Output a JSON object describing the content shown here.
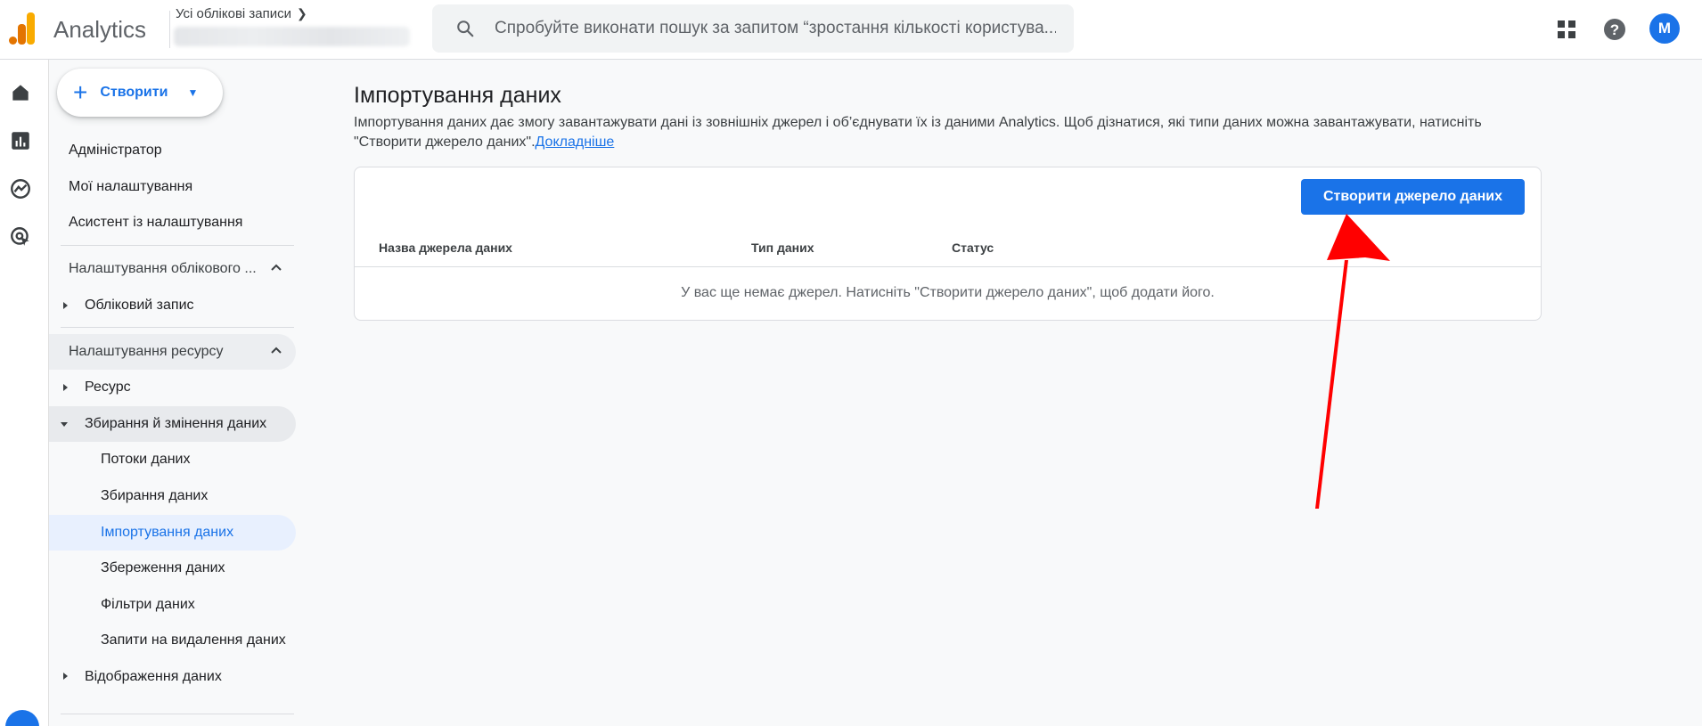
{
  "header": {
    "app_name": "Analytics",
    "breadcrumb": "Усі облікові записи",
    "search_placeholder": "Спробуйте виконати пошук за запитом “зростання кількості користува...",
    "avatar_letter": "M"
  },
  "colors": {
    "brand_orange": "#f9ab00",
    "brand_dark_orange": "#e37400",
    "accent_blue": "#1a73e8",
    "annotation_red": "#ff0000"
  },
  "icons": [
    "analytics-logo-icon",
    "search-icon",
    "apps-grid-icon",
    "help-icon",
    "home-icon",
    "reports-icon",
    "explore-icon",
    "advertising-icon",
    "admin-gear-icon"
  ],
  "sidebar": {
    "create_label": "Створити",
    "admin": "Адміністратор",
    "my_settings": "Мої налаштування",
    "setup_assistant": "Асистент із налаштування",
    "account_settings": "Налаштування облікового ...",
    "account": "Обліковий запис",
    "property_settings": "Налаштування ресурсу",
    "property": "Ресурс",
    "data_collection": "Збирання й змінення даних",
    "data_streams": "Потоки даних",
    "data_collection_sub": "Збирання даних",
    "data_import": "Імпортування даних",
    "data_retention": "Збереження даних",
    "data_filters": "Фільтри даних",
    "data_deletion": "Запити на видалення даних",
    "data_display": "Відображення даних"
  },
  "main": {
    "title": "Імпортування даних",
    "description": "Імпортування даних дає змогу завантажувати дані із зовнішніх джерел і об’єднувати їх із даними Analytics. Щоб дізнатися, які типи даних можна завантажувати, натисніть \"Створити джерело даних\".",
    "learn_more": "Докладніше",
    "create_source_button": "Створити джерело даних",
    "columns": [
      "Назва джерела даних",
      "Тип даних",
      "Статус"
    ],
    "empty_message": "У вас ще немає джерел. Натисніть \"Створити джерело даних\", щоб додати його."
  }
}
